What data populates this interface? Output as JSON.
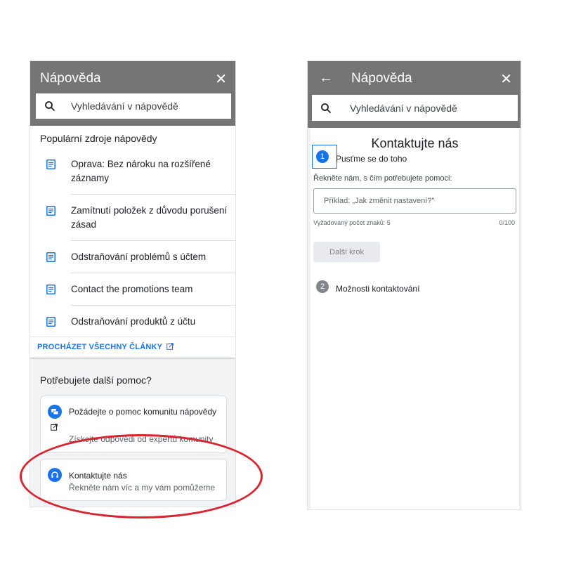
{
  "left": {
    "header": {
      "title": "Nápověda",
      "close_icon": "close-icon"
    },
    "search": {
      "placeholder": "Vyhledávání v nápovědě"
    },
    "popular": {
      "title": "Populární zdroje nápovědy",
      "articles": [
        {
          "label": "Oprava: Bez nároku na rozšířené záznamy"
        },
        {
          "label": "Zamítnutí položek z důvodu porušení zásad"
        },
        {
          "label": "Odstraňování problémů s účtem"
        },
        {
          "label": "Contact the promotions team"
        },
        {
          "label": "Odstraňování produktů z účtu"
        }
      ],
      "browse_all": "PROCHÁZET VŠECHNY ČLÁNKY"
    },
    "more_help": {
      "title": "Potřebujete další pomoc?",
      "community": {
        "title": "Požádejte o pomoc komunitu nápovědy",
        "subtitle": "Získejte odpovědi od expertů komunity"
      },
      "contact": {
        "title": "Kontaktujte nás",
        "subtitle": "Řekněte nám víc a my vám pomůžeme"
      }
    }
  },
  "right": {
    "header": {
      "title": "Nápověda"
    },
    "search": {
      "placeholder": "Vyhledávání v nápovědě"
    },
    "form": {
      "title": "Kontaktujte nás",
      "step1": {
        "number": "1",
        "label": "Pusťme se do toho"
      },
      "question": "Řekněte nám, s čím potřebujete pomoci:",
      "textarea_placeholder": "Příklad: „Jak změnit nastavení?\"",
      "required_chars": "Vyžadovaný počet znaků: 5",
      "char_count": "0/100",
      "next_button": "Další krok",
      "step2": {
        "number": "2",
        "label": "Možnosti kontaktování"
      }
    }
  },
  "colors": {
    "header_bg": "#757575",
    "accent_blue": "#1a73e8",
    "annotation_red": "#d9232e"
  }
}
